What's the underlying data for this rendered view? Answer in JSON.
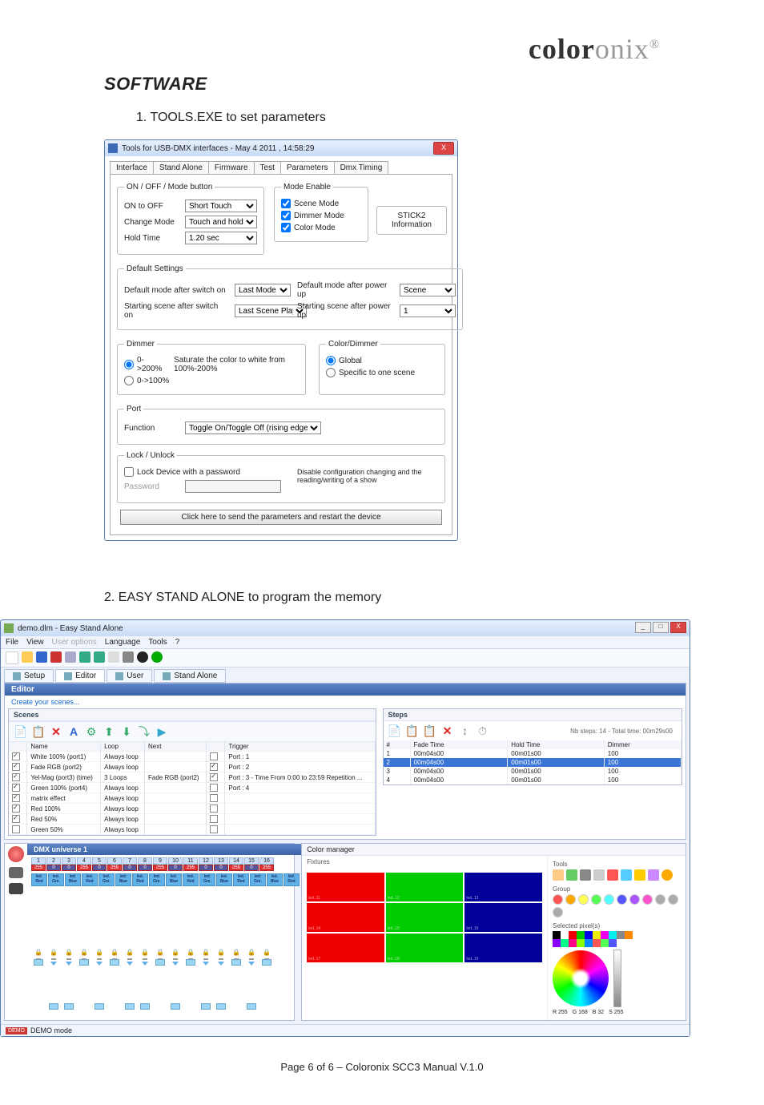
{
  "logo": {
    "bold": "color",
    "light": "onix",
    "reg": "®"
  },
  "heading": "SOFTWARE",
  "step1": "1.   TOOLS.EXE to set parameters",
  "step2": "2. EASY STAND ALONE to program the memory",
  "footer": "Page 6 of 6 – Coloronix SCC3 Manual V.1.0",
  "tools": {
    "title": "Tools for USB-DMX interfaces - May  4 2011 , 14:58:29",
    "close": "X",
    "tabs": [
      "Interface",
      "Stand Alone",
      "Firmware",
      "Test",
      "Parameters",
      "Dmx Timing"
    ],
    "onoff": {
      "legend": "ON / OFF / Mode button",
      "on_to_off_lbl": "ON to OFF",
      "on_to_off_val": "Short Touch",
      "change_mode_lbl": "Change Mode",
      "change_mode_val": "Touch and hold",
      "hold_time_lbl": "Hold Time",
      "hold_time_val": "1.20 sec"
    },
    "modeenable": {
      "legend": "Mode Enable",
      "scene": "Scene Mode",
      "scene_on": true,
      "dimmer": "Dimmer Mode",
      "dimmer_on": true,
      "color": "Color Mode",
      "color_on": true
    },
    "stick2": {
      "line1": "STICK2",
      "line2": "Information"
    },
    "defaults": {
      "legend": "Default Settings",
      "dmo_lbl": "Default mode after switch on",
      "dmo_val": "Last Mode",
      "ssa_lbl": "Starting scene after switch on",
      "ssa_val": "Last Scene Played",
      "dmp_lbl": "Default mode after power up",
      "dmp_val": "Scene",
      "ssp_lbl": "Starting scene after power up",
      "ssp_val": "1"
    },
    "dimmer": {
      "legend": "Dimmer",
      "opt200": "0->200%",
      "opt200_note": "Saturate the color to white from 100%-200%",
      "opt100": "0->100%"
    },
    "cd": {
      "legend": "Color/Dimmer",
      "global": "Global",
      "specific": "Specific to one scene"
    },
    "port": {
      "legend": "Port",
      "func_lbl": "Function",
      "func_val": "Toggle On/Toggle Off (rising edge)"
    },
    "lock": {
      "legend": "Lock / Unlock",
      "chk": "Lock Device with a password",
      "pw_lbl": "Password",
      "note": "Disable configuration changing and the reading/writing of a show"
    },
    "send": "Click here to send the parameters and restart the device"
  },
  "esa": {
    "title": "demo.dlm - Easy Stand Alone",
    "menu": [
      "File",
      "View",
      "User options",
      "Language",
      "Tools",
      "?"
    ],
    "subtabs": [
      "Setup",
      "Editor",
      "User",
      "Stand Alone"
    ],
    "editor_label": "Editor",
    "create_scenes": "Create your scenes...",
    "scenes_label": "Scenes",
    "scene_cols": [
      "",
      "Name",
      "Loop",
      "Next",
      "",
      "Trigger"
    ],
    "scenes": [
      {
        "chk": true,
        "name": "White 100% (port1)",
        "loop": "Always loop",
        "next": "",
        "trig": "Port : 1",
        "tbox": false
      },
      {
        "chk": true,
        "name": "Fade RGB (port2)",
        "loop": "Always loop",
        "next": "",
        "trig": "Port : 2",
        "tbox": true
      },
      {
        "chk": true,
        "name": "Yel-Mag (port3) (time)",
        "loop": "3 Loops",
        "next": "Fade RGB (port2)",
        "trig": "Port : 3 - Time From 0:00  to  23:59 Repetition ...",
        "tbox": true
      },
      {
        "chk": true,
        "name": "Green 100% (port4)",
        "loop": "Always loop",
        "next": "",
        "trig": "Port : 4",
        "tbox": false
      },
      {
        "chk": true,
        "name": "matrix effect",
        "loop": "Always loop",
        "next": "",
        "trig": "",
        "tbox": false
      },
      {
        "chk": true,
        "name": "Red 100%",
        "loop": "Always loop",
        "next": "",
        "trig": "",
        "tbox": false
      },
      {
        "chk": true,
        "name": "Red 50%",
        "loop": "Always loop",
        "next": "",
        "trig": "",
        "tbox": false
      },
      {
        "chk": false,
        "name": "Green 50%",
        "loop": "Always loop",
        "next": "",
        "trig": "",
        "tbox": false
      }
    ],
    "steps_label": "Steps",
    "steps_info": "Nb steps: 14 - Total time: 00m29s00",
    "step_cols": [
      "#",
      "Fade Time",
      "Hold Time",
      "Dimmer"
    ],
    "steps": [
      {
        "n": "1",
        "fade": "00m04s00",
        "hold": "00m01s00",
        "dim": "100",
        "sel": false
      },
      {
        "n": "2",
        "fade": "00m04s00",
        "hold": "00m01s00",
        "dim": "100",
        "sel": true
      },
      {
        "n": "3",
        "fade": "00m04s00",
        "hold": "00m01s00",
        "dim": "100",
        "sel": false
      },
      {
        "n": "4",
        "fade": "00m04s00",
        "hold": "00m01s00",
        "dim": "100",
        "sel": false
      }
    ],
    "dmx_label": "DMX universe 1",
    "channels": [
      {
        "n": "1",
        "v": "255"
      },
      {
        "n": "2",
        "v": "0"
      },
      {
        "n": "3",
        "v": "0"
      },
      {
        "n": "4",
        "v": "255"
      },
      {
        "n": "5",
        "v": "0"
      },
      {
        "n": "6",
        "v": "255"
      },
      {
        "n": "7",
        "v": "0"
      },
      {
        "n": "8",
        "v": "0"
      },
      {
        "n": "9",
        "v": "255"
      },
      {
        "n": "10",
        "v": "0"
      },
      {
        "n": "11",
        "v": "255"
      },
      {
        "n": "12",
        "v": "0"
      },
      {
        "n": "13",
        "v": "0"
      },
      {
        "n": "14",
        "v": "255"
      },
      {
        "n": "15",
        "v": "0"
      },
      {
        "n": "16",
        "v": "255"
      }
    ],
    "fix_lbls": [
      "led. Red",
      "led. Gre.",
      "led. Blue",
      "led. Red",
      "led. Gre.",
      "led. Blue",
      "led. Red",
      "led. Gre.",
      "led. Blue",
      "led. Red",
      "led. Gre.",
      "led. Blue",
      "led. Red",
      "led. Gre.",
      "led. Blue",
      "led. Red"
    ],
    "cm": {
      "title": "Color manager",
      "fixtures_lbl": "Fixtures",
      "tools_lbl": "Tools",
      "group_lbl": "Group",
      "selected_lbl": "Selected pixel(s)",
      "cells": [
        "red",
        "green",
        "blue",
        "red",
        "green",
        "blue",
        "red",
        "green",
        "blue"
      ],
      "cell_lbl": [
        "led..11",
        "led..12",
        "led..13",
        "led..14",
        "led..15",
        "led..16",
        "led..17",
        "led..18",
        "led..19"
      ],
      "rgb": {
        "r": "R 255",
        "g": "G 168",
        "b": "B 32",
        "s": "S 255"
      }
    },
    "status": {
      "demo": "DEMO",
      "text": "DEMO mode"
    },
    "swatch_colors": [
      "#000",
      "#fff",
      "#e00",
      "#0c0",
      "#00e",
      "#ee0",
      "#e0e",
      "#0ee",
      "#888",
      "#f80",
      "#80f",
      "#0f8",
      "#f08",
      "#8f0",
      "#08f",
      "#f55",
      "#5f5",
      "#55f"
    ]
  }
}
